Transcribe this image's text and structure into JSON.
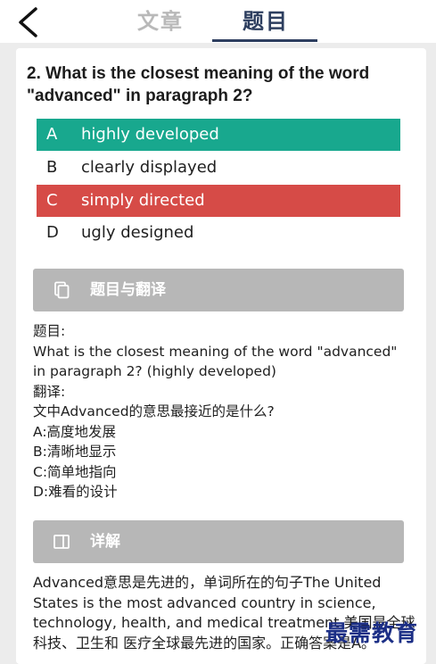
{
  "header": {
    "tabs": [
      {
        "label": "文章"
      },
      {
        "label": "题目"
      }
    ]
  },
  "question": {
    "text": "2. What is the closest meaning of the word \"advanced\" in paragraph 2?",
    "options": [
      {
        "letter": "A",
        "text": "highly developed",
        "state": "correct"
      },
      {
        "letter": "B",
        "text": "clearly displayed",
        "state": "normal"
      },
      {
        "letter": "C",
        "text": "simply directed",
        "state": "wrong"
      },
      {
        "letter": "D",
        "text": "ugly designed",
        "state": "normal"
      }
    ]
  },
  "translation_section": {
    "title": "题目与翻译",
    "lines": [
      "题目:",
      "What is the closest meaning of the word \"advanced\"",
      "in paragraph 2? (highly developed)",
      "翻译:",
      "文中Advanced的意思最接近的是什么?",
      "A:高度地发展",
      "B:清晰地显示",
      "C:简单地指向",
      "D:难看的设计"
    ]
  },
  "analysis_section": {
    "title": "详解",
    "text": "Advanced意思是先进的，单词所在的句子The United States is the most advanced country in science, technology, health, and medical treatment 美国是全球科技、卫生和 医疗全球最先进的国家。正确答案是A。"
  },
  "watermark": {
    "text": "最需教育"
  },
  "colors": {
    "correct": "#18a88e",
    "wrong": "#d64b47",
    "section_bar": "#b7b7b7",
    "active_tab": "#2d3e5f"
  }
}
